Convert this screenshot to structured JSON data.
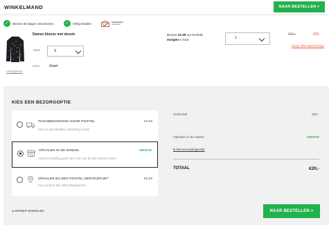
{
  "header": {
    "title": "WINKELMAND",
    "checkout_button": "NAAR BESTELLEN >"
  },
  "usps": [
    {
      "icon": "check-icon",
      "text": "Binnen 60 dagen retourneren"
    },
    {
      "icon": "check-icon",
      "text": "Veilig betalen"
    }
  ],
  "thuiswinkel": {
    "line1": "thuiswinkel",
    "line2": "waarborg"
  },
  "product": {
    "name": "Dames blouse met dessin",
    "size_label": "Maat",
    "size_value": "S",
    "color_label": "Kleur",
    "color_value": "Zwart",
    "remove_link": "Verwijderen",
    "delivery_prefix": "Binnen ",
    "delivery_time": "12:30",
    "delivery_mid": " uur besteld,",
    "delivery_day": "morgen",
    "delivery_suffix": " in huis",
    "quantity": "1",
    "price_old": "€50,-",
    "price_new": "€20,",
    "sale_link": "SALE 20% extra korting"
  },
  "shipping": {
    "title": "KIES EEN BEZORGOPTIE",
    "options": [
      {
        "name": "THUISBEZORGING DOOR POSTNL",
        "desc": "Snel en gemakkelijk je bestelling in huis",
        "price": "€3,99",
        "selected": false,
        "icon": "delivery-truck-icon"
      },
      {
        "name": "OPHALEN IN DE WINKEL",
        "desc": "Haal je bestelling gratis op in een van de WE Fashion stores",
        "price": "GRATIS",
        "selected": true,
        "icon": "store-icon"
      },
      {
        "name": "OPHALEN BIJ EEN POSTNL SERVICEPUNT",
        "desc": "Kies uit meer dan 2500 afhaalpunten",
        "price": "€3,99",
        "selected": false,
        "icon": "map-pin-icon"
      }
    ]
  },
  "summary": {
    "subtotal_label": "Subtotaal",
    "subtotal_value": "€20,-",
    "pickup_label": "Ophalen in de winkel",
    "pickup_value": "GRATIS",
    "promo_link": "Ik heb een kortingscode",
    "total_label": "TOTAAL",
    "total_value": "€20,-"
  },
  "footer": {
    "back_link": "VERDER WINKELEN",
    "checkout_button": "NAAR BESTELLEN >"
  },
  "colors": {
    "accent": "#22b14c",
    "sale": "#e8552b",
    "panel": "#f1f1f1"
  }
}
